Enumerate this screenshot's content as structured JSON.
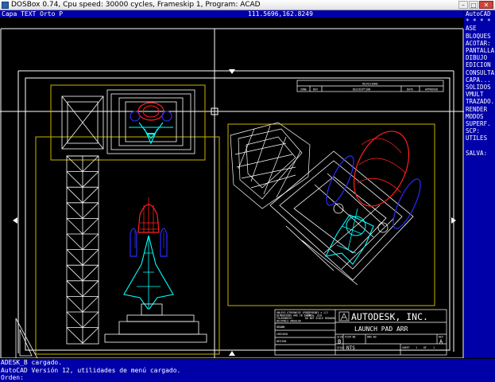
{
  "window": {
    "title": "DOSBox 0.74, Cpu speed:    30000 cycles, Frameskip  1, Program:    ACAD",
    "min_glyph": "–",
    "max_glyph": "□",
    "close_glyph": "✕"
  },
  "status": {
    "layer_mode": "Capa TEXT Orto P",
    "coords": "111.5696,162.8249"
  },
  "side_menu": {
    "header": "AutoCAD",
    "stars": "* * * *",
    "items": [
      "ASE",
      "BLOQUES",
      "ACOTAR:",
      "PANTALLA",
      "DIBUJO",
      "EDICION",
      "CONSULTA",
      "CAPA...",
      "SOLIDOS",
      "VMULT",
      "TRAZADO..",
      "RENDER",
      "MODOS",
      "SUPERF.",
      "SCP:",
      "UTILES"
    ],
    "footer": "SALVA:"
  },
  "command_lines": [
    "ADESK_B cargado.",
    "AutoCAD Versión 12, utilidades de menú cargado.",
    "Orden:"
  ],
  "revisions": {
    "title": "REVISIONS",
    "columns": [
      "ZONE",
      "REV",
      "DESCRIPTION",
      "DATE",
      "APPROVED"
    ]
  },
  "title_block": {
    "notes": [
      "UNLESS OTHERWISE SPECIFIED",
      "DIMENSIONS ARE IN INCHES",
      "TOLERANCES:",
      "DECIMALS  ANGULAR",
      ".XX ± .03   ± 1/2",
      ".XXX ± .010",
      "DO NOT SCALE DRAWING"
    ],
    "company": "AUTODESK, INC.",
    "drawing_title": "LAUNCH PAD ARR",
    "left_rows": [
      "DRAWN",
      "CHECKED",
      "DESIGN"
    ],
    "size_label": "SIZE",
    "size_value": "B",
    "fscm_label": "FSCM NO",
    "dwg_label": "DWG NO",
    "rev_label": "REV",
    "rev_value": "A",
    "scale_label": "SCALE",
    "scale_value": "NTS",
    "sheet_label": "SHEET",
    "sheet_value": "1",
    "of_label": "OF",
    "of_value": "1"
  },
  "colors": {
    "background": "#000000",
    "menu_blue": "#0000a8",
    "white": "#ffffff",
    "red": "#ff2020",
    "blue": "#2a2aff",
    "cyan": "#00ffff",
    "yellow": "#c8b400"
  }
}
